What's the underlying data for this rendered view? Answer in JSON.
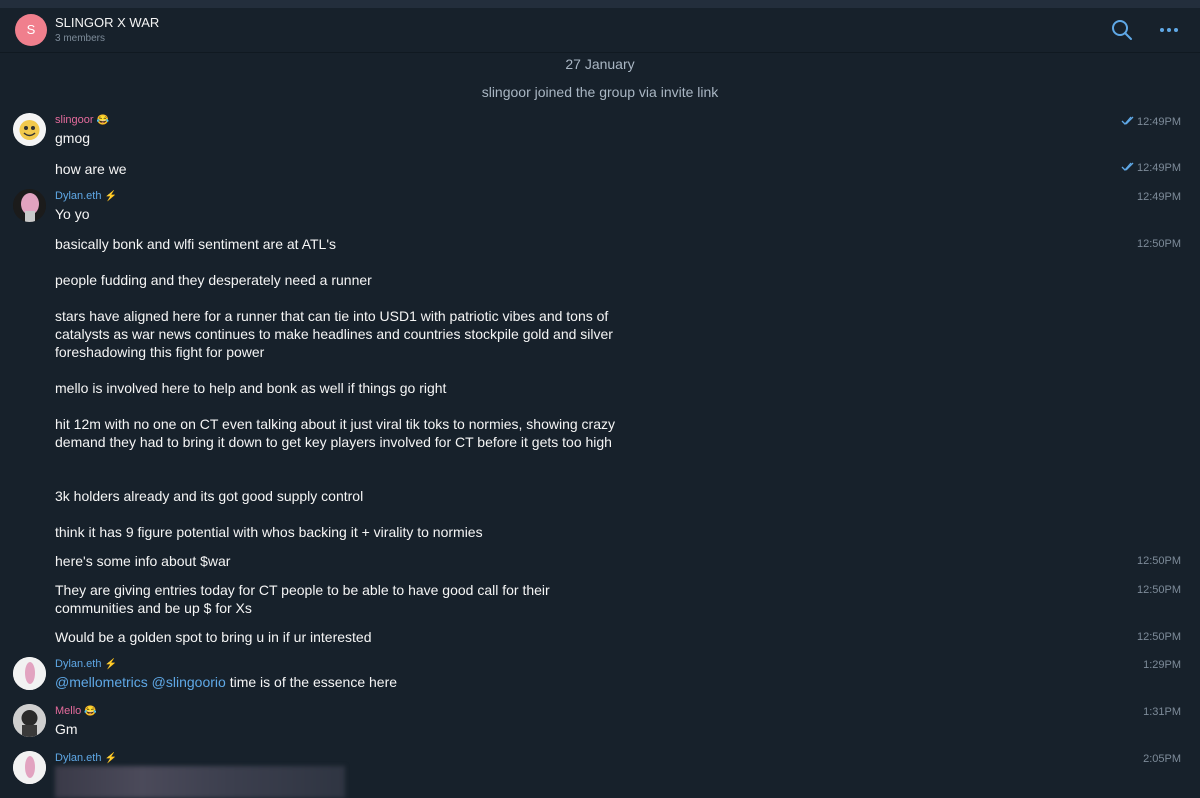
{
  "header": {
    "avatar_letter": "S",
    "title": "SLINGOR X WAR",
    "subtitle": "3 members"
  },
  "system": {
    "date": "27 January",
    "join_notice": "slingoor joined the group via invite link"
  },
  "messages": [
    {
      "author": "slingoor",
      "text": "gmog",
      "time": "12:49PM",
      "read": true
    },
    {
      "text": "how are we",
      "time": "12:49PM",
      "read": true
    },
    {
      "author": "Dylan.eth",
      "text": "Yo yo",
      "time": "12:49PM"
    },
    {
      "text": "basically bonk and wlfi sentiment are at ATL's",
      "time": "12:50PM"
    },
    {
      "text": "people fudding and they desperately need a runner"
    },
    {
      "text": "stars have aligned here for a runner that can tie into USD1 with patriotic vibes and tons of catalysts as war news continues to make headlines and countries stockpile gold and silver foreshadowing this fight for power"
    },
    {
      "text": "mello is involved here to help and bonk as well if things go right"
    },
    {
      "text": "hit 12m with no one on CT even talking about it just viral tik toks to normies, showing crazy demand they had to bring it down to get key players involved for CT before it gets too high"
    },
    {
      "text": "3k holders already and its got good supply control"
    },
    {
      "text": "think it has 9 figure potential with whos backing it + virality to normies"
    },
    {
      "text": "here's some info about $war",
      "time": "12:50PM"
    },
    {
      "text": "They are giving entries today for CT people to be able to have good call for their communities and be up $ for Xs",
      "time": "12:50PM"
    },
    {
      "text": "Would be a golden spot to bring u in if ur interested",
      "time": "12:50PM"
    },
    {
      "author": "Dylan.eth",
      "mention1": "@mellometrics",
      "mention2": "@slingoorio",
      "text": " time is of the essence here",
      "time": "1:29PM"
    },
    {
      "author": "Mello",
      "text": "Gm",
      "time": "1:31PM"
    },
    {
      "author": "Dylan.eth",
      "time": "2:05PM"
    }
  ],
  "colors": {
    "background": "#17212b",
    "name_blue": "#5fa8e6",
    "name_pink": "#e46b9c",
    "time_gray": "#7d8b99"
  },
  "icons": [
    "search-icon",
    "more-icon",
    "double-check-icon",
    "verified-badge-icon",
    "emoji-badge-icon"
  ]
}
